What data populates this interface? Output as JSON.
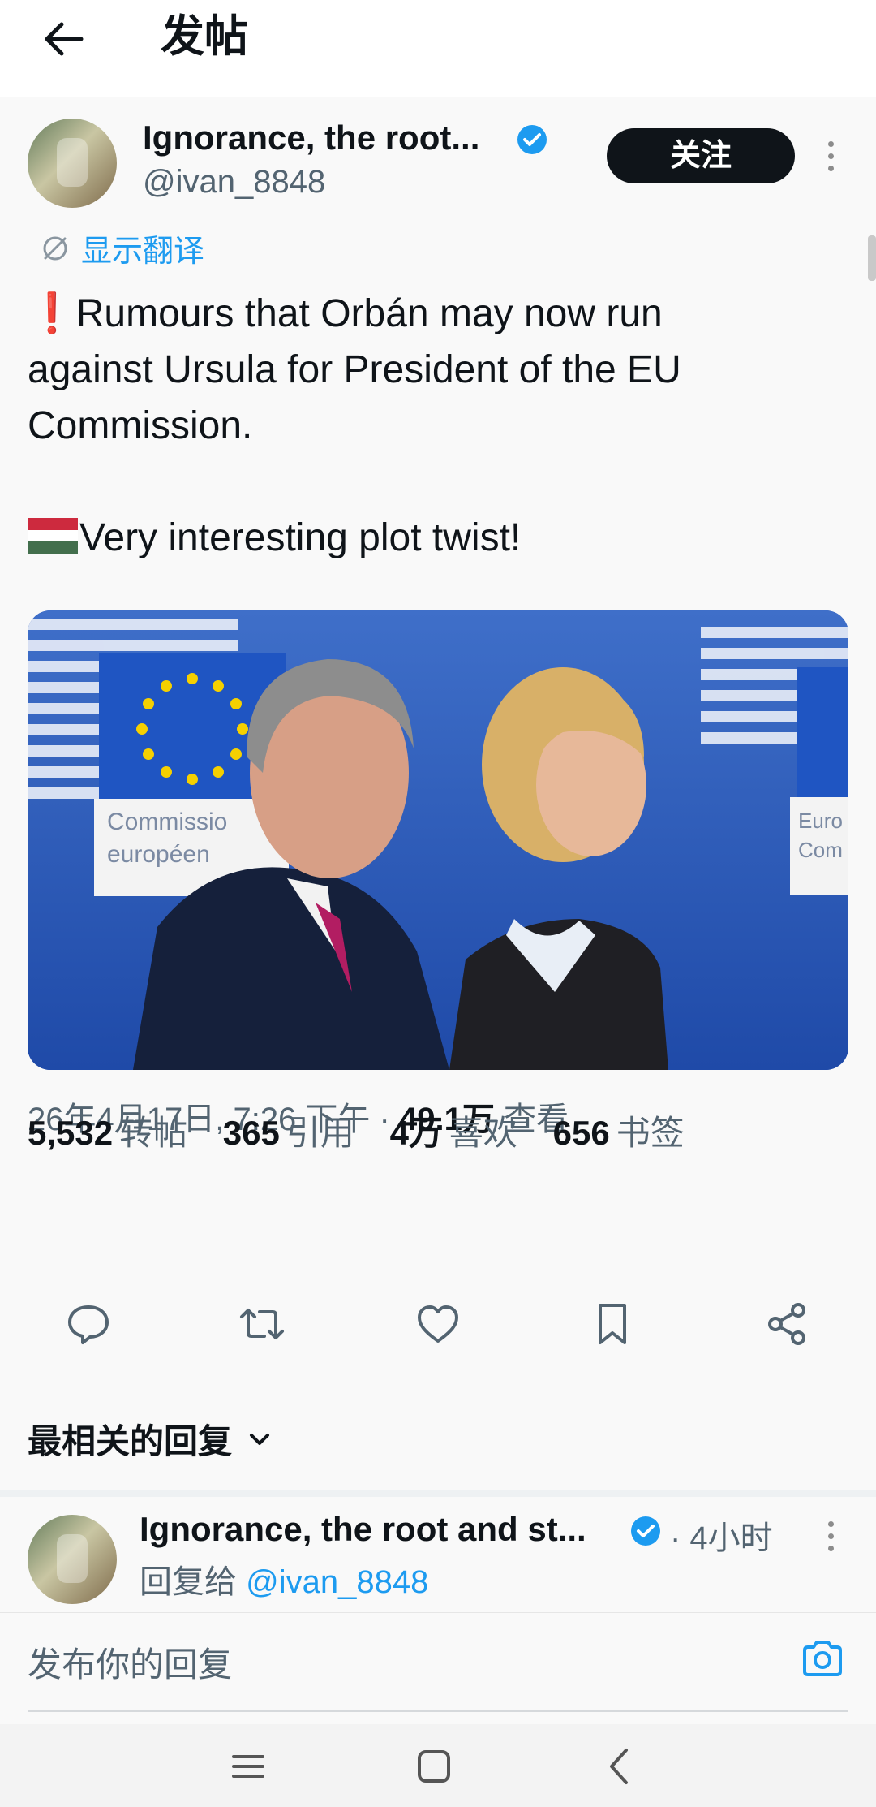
{
  "header": {
    "title": "发帖",
    "back_icon": "back-arrow-icon"
  },
  "post": {
    "author_name": "Ignorance, the root...",
    "handle": "@ivan_8848",
    "verified": true,
    "follow_label": "关注",
    "translate_label": "显示翻译",
    "text_lines": [
      "Rumours that Orbán may now run",
      "against Ursula for President of the EU",
      "Commission."
    ],
    "text_line2": "Very interesting plot twist!",
    "image_sign_left": [
      "Commissio",
      "européen"
    ],
    "image_sign_right": [
      "Euro",
      "Com"
    ],
    "meta_time": "26年4月17日, 7:26 下午 · ",
    "meta_views": "49.1万",
    "meta_views_label": " 查看",
    "stats": [
      {
        "value": "5,532",
        "label": "转帖"
      },
      {
        "value": "365",
        "label": "引用"
      },
      {
        "value": "4万",
        "label": "喜欢"
      },
      {
        "value": "656",
        "label": "书签"
      }
    ]
  },
  "sort_label": "最相关的回复",
  "reply": {
    "author_name": "Ignorance, the root and st...",
    "time": "· 4小时",
    "reply_to_prefix": "回复给 ",
    "reply_to_handle": "@ivan_8848"
  },
  "composer": {
    "placeholder": "发布你的回复"
  },
  "colors": {
    "accent": "#1d9bf0",
    "text": "#0f1419",
    "muted": "#536471",
    "follow_bg": "#0f1419"
  },
  "icons": [
    "reply-icon",
    "retweet-icon",
    "like-icon",
    "bookmark-icon",
    "share-icon",
    "camera-icon"
  ]
}
